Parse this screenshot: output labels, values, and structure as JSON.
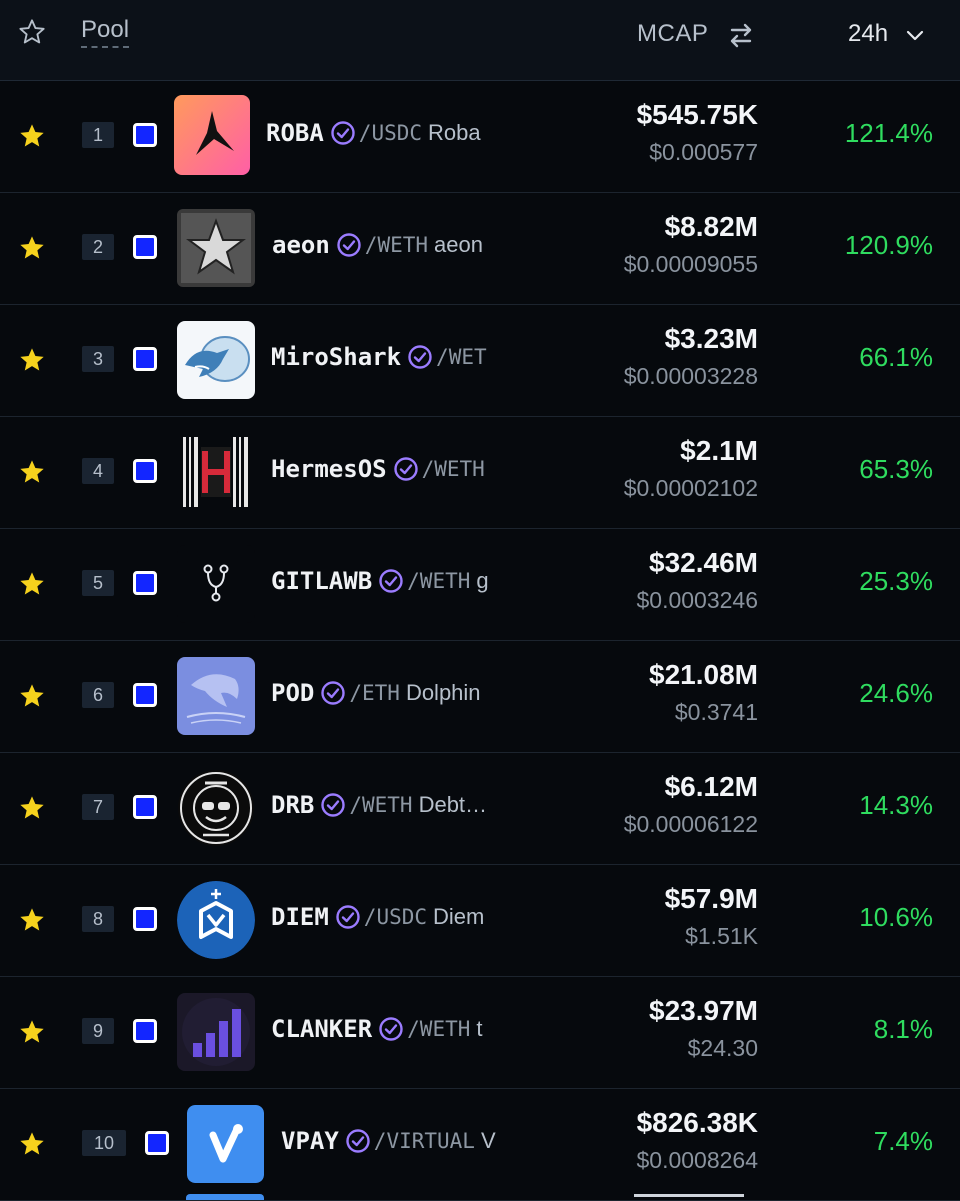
{
  "header": {
    "pool_label": "Pool",
    "mcap_label": "MCAP",
    "period_label": "24h",
    "icons": [
      "star-outline-icon",
      "swap-arrows-icon",
      "chevron-down-icon"
    ]
  },
  "colors": {
    "background": "#06090d",
    "header_bg": "#0c1118",
    "positive": "#2fdc5f",
    "favorite": "#f6d21d",
    "checkbox": "#1326ff",
    "verify": "#9b7cff"
  },
  "pools": [
    {
      "rank": "1",
      "symbol": "ROBA",
      "quote": "/USDC",
      "name": "Roba",
      "mcap": "$545.75K",
      "price": "$0.000577",
      "change": "121.4%",
      "logo": "roba-logo"
    },
    {
      "rank": "2",
      "symbol": "aeon",
      "quote": "/WETH",
      "name": "aeon",
      "mcap": "$8.82M",
      "price": "$0.00009055",
      "change": "120.9%",
      "logo": "aeon-logo"
    },
    {
      "rank": "3",
      "symbol": "MiroShark",
      "quote": "/WET",
      "name": "",
      "mcap": "$3.23M",
      "price": "$0.00003228",
      "change": "66.1%",
      "logo": "miroshark-logo"
    },
    {
      "rank": "4",
      "symbol": "HermesOS",
      "quote": "/WETH",
      "name": "",
      "mcap": "$2.1M",
      "price": "$0.00002102",
      "change": "65.3%",
      "logo": "hermesos-logo"
    },
    {
      "rank": "5",
      "symbol": "GITLAWB",
      "quote": "/WETH",
      "name": "g",
      "mcap": "$32.46M",
      "price": "$0.0003246",
      "change": "25.3%",
      "logo": "gitlawb-logo"
    },
    {
      "rank": "6",
      "symbol": "POD",
      "quote": "/ETH",
      "name": "Dolphin",
      "mcap": "$21.08M",
      "price": "$0.3741",
      "change": "24.6%",
      "logo": "pod-logo"
    },
    {
      "rank": "7",
      "symbol": "DRB",
      "quote": "/WETH",
      "name": "Debt…",
      "mcap": "$6.12M",
      "price": "$0.00006122",
      "change": "14.3%",
      "logo": "drb-logo"
    },
    {
      "rank": "8",
      "symbol": "DIEM",
      "quote": "/USDC",
      "name": "Diem",
      "mcap": "$57.9M",
      "price": "$1.51K",
      "change": "10.6%",
      "logo": "diem-logo"
    },
    {
      "rank": "9",
      "symbol": "CLANKER",
      "quote": "/WETH",
      "name": "t",
      "mcap": "$23.97M",
      "price": "$24.30",
      "change": "8.1%",
      "logo": "clanker-logo"
    },
    {
      "rank": "10",
      "symbol": "VPAY",
      "quote": "/VIRTUAL",
      "name": "V",
      "mcap": "$826.38K",
      "price": "$0.0008264",
      "change": "7.4%",
      "logo": "vpay-logo"
    }
  ]
}
